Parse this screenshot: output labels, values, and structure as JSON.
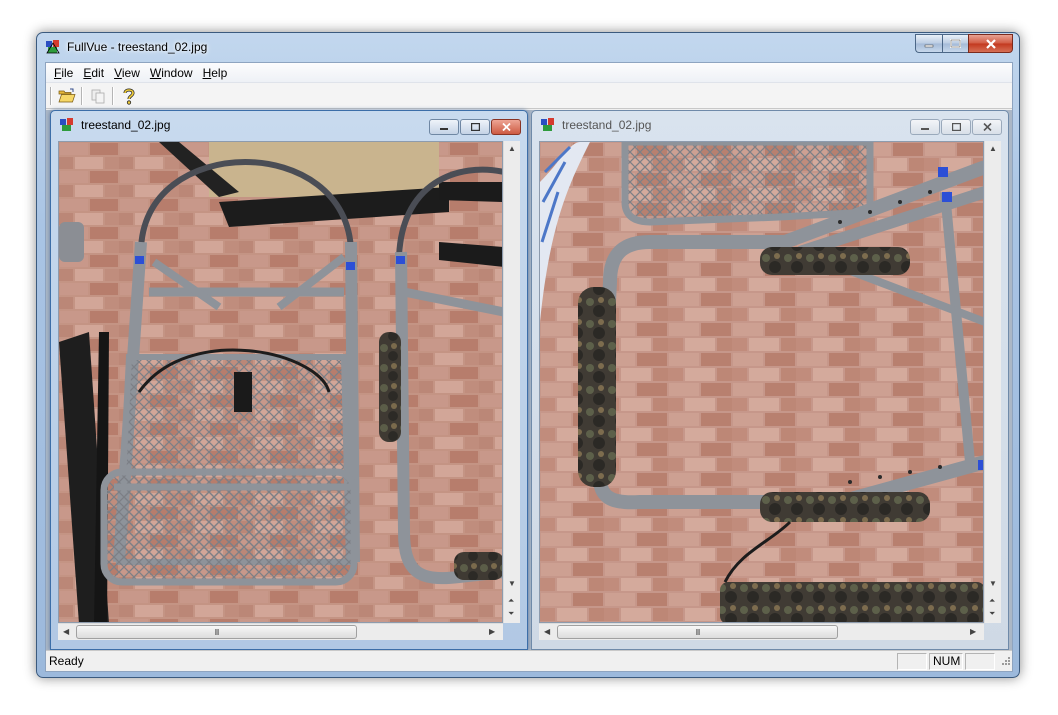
{
  "window": {
    "title": "FullVue - treestand_02.jpg"
  },
  "menu": [
    {
      "label": "File",
      "accel": "F",
      "rest": "ile"
    },
    {
      "label": "Edit",
      "accel": "E",
      "rest": "dit"
    },
    {
      "label": "View",
      "accel": "V",
      "rest": "iew"
    },
    {
      "label": "Window",
      "accel": "W",
      "rest": "indow"
    },
    {
      "label": "Help",
      "accel": "H",
      "rest": "elp"
    }
  ],
  "toolbar": {
    "open_icon": "folder-open-icon",
    "copy_icon": "copy-icon",
    "help_icon": "help-question-icon"
  },
  "children": [
    {
      "title": "treestand_02.jpg",
      "state": "active"
    },
    {
      "title": "treestand_02.jpg",
      "state": "inactive"
    }
  ],
  "scroll": {
    "h_thumb_label": "III"
  },
  "status": {
    "text": "Ready",
    "pane_1": "",
    "pane_2": "NUM",
    "pane_3": ""
  },
  "colors": {
    "title_gradient_top": "#c2d7ee",
    "title_gradient_bottom": "#9cb9dc",
    "close_red": "#c3391f",
    "brick": "#b98a7a",
    "metal": "#8e939a"
  }
}
